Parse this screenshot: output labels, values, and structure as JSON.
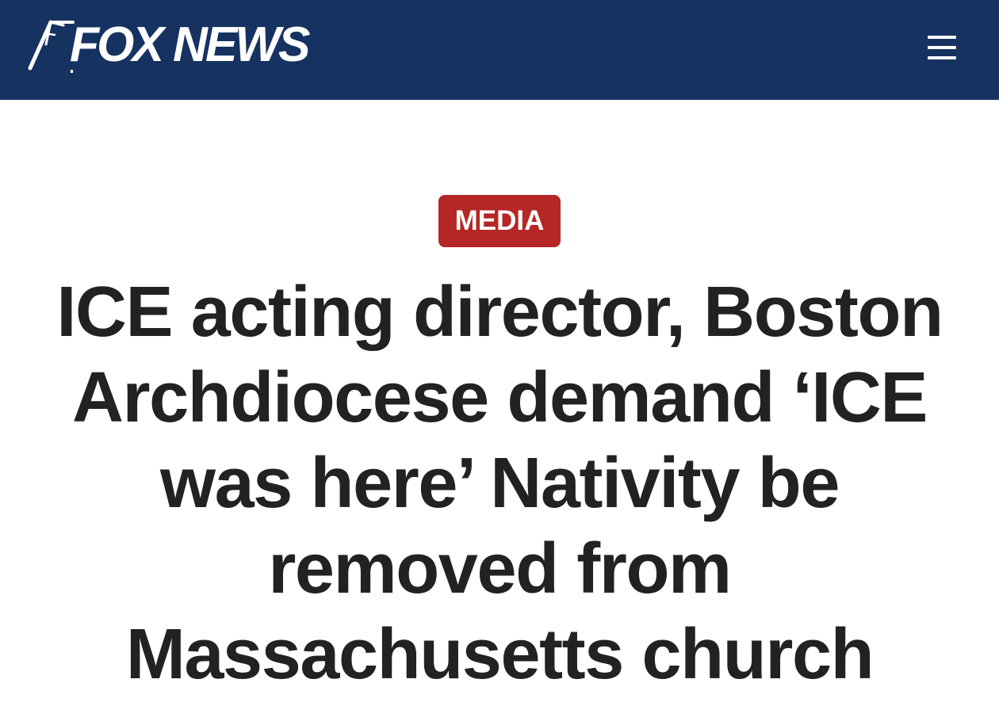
{
  "header": {
    "logo_text": "FOX NEWS",
    "menu_icon": "hamburger-menu-icon",
    "background_color": "#163261"
  },
  "article": {
    "category_label": "MEDIA",
    "category_color": "#b42726",
    "headline": "ICE acting director, Boston Archdiocese demand ‘ICE was here’ Nativity be removed from Massachusetts church"
  }
}
